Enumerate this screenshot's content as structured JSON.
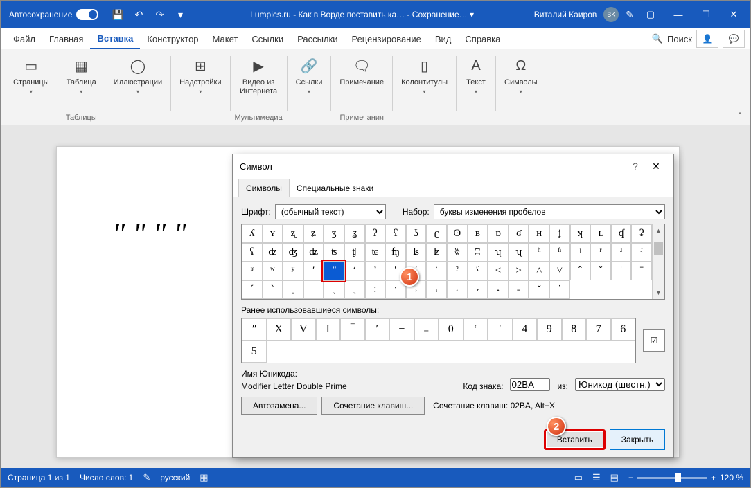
{
  "titlebar": {
    "autosave": "Автосохранение",
    "title": "Lumpics.ru - Как в Ворде поставить ка… - Сохранение… ▾",
    "user": "Виталий Каиров",
    "initials": "BK"
  },
  "menu": {
    "tabs": [
      "Файл",
      "Главная",
      "Вставка",
      "Конструктор",
      "Макет",
      "Ссылки",
      "Рассылки",
      "Рецензирование",
      "Вид",
      "Справка"
    ],
    "active_index": 2,
    "search_placeholder": "Поиск"
  },
  "ribbon": {
    "groups": [
      {
        "label": "",
        "items": [
          {
            "icon": "▭",
            "text": "Страницы",
            "arrow": true
          }
        ]
      },
      {
        "label": "Таблицы",
        "items": [
          {
            "icon": "▦",
            "text": "Таблица",
            "arrow": true
          }
        ]
      },
      {
        "label": "",
        "items": [
          {
            "icon": "◯",
            "text": "Иллюстрации",
            "arrow": true
          }
        ]
      },
      {
        "label": "",
        "items": [
          {
            "icon": "⊞",
            "text": "Надстройки",
            "arrow": true
          }
        ]
      },
      {
        "label": "Мультимедиа",
        "items": [
          {
            "icon": "▶",
            "text": "Видео из\nИнтернета"
          }
        ]
      },
      {
        "label": "",
        "items": [
          {
            "icon": "🔗",
            "text": "Ссылки",
            "arrow": true
          }
        ]
      },
      {
        "label": "Примечания",
        "items": [
          {
            "icon": "🗨",
            "text": "Примечание"
          }
        ]
      },
      {
        "label": "",
        "items": [
          {
            "icon": "▯",
            "text": "Колонтитулы",
            "arrow": true
          }
        ]
      },
      {
        "label": "",
        "items": [
          {
            "icon": "A",
            "text": "Текст",
            "arrow": true
          }
        ]
      },
      {
        "label": "",
        "items": [
          {
            "icon": "Ω",
            "text": "Символы",
            "arrow": true
          }
        ]
      }
    ]
  },
  "document": {
    "text": "ʺ ʺ ʺ ʺ"
  },
  "dialog": {
    "title": "Символ",
    "tabs": [
      "Символы",
      "Специальные знаки"
    ],
    "font_label": "Шрифт:",
    "font_value": "(обычный текст)",
    "subset_label": "Набор:",
    "subset_value": "буквы изменения пробелов",
    "chars": [
      [
        "ʎ",
        "ʏ",
        "ʐ",
        "ʑ",
        "ʒ",
        "ʓ",
        "ʔ",
        "ʕ",
        "ʖ",
        "ʗ",
        "ʘ",
        "ʙ",
        "ɒ",
        "ʛ",
        "ʜ",
        "ʝ",
        "ʞ",
        "ʟ",
        "ʠ"
      ],
      [
        "ʡ",
        "ʢ",
        "ʣ",
        "ʤ",
        "ʥ",
        "ʦ",
        "ʧ",
        "ʨ",
        "ʩ",
        "ʪ",
        "ʫ",
        "ʬ",
        "ʭ",
        "ʮ",
        "ʯ",
        "ʰ",
        "ʱ",
        "ʲ",
        "ʳ"
      ],
      [
        "ʴ",
        "ʵ",
        "ʶ",
        "ʷ",
        "ʸ",
        "ʹ",
        "ʺ",
        "ʻ",
        "ʼ",
        "ʽ",
        "ʾ",
        "ʿ",
        "ˀ",
        "ˁ",
        "˂",
        "˃",
        "˄",
        "˅",
        "ˆ"
      ],
      [
        "ˇ",
        "ˈ",
        "ˉ",
        "ˊ",
        "ˋ",
        "ˌ",
        "ˍ",
        "ˎ",
        "ˏ",
        "ː",
        "ˑ",
        "˒",
        "˓",
        "˔",
        "˕",
        "˖",
        "˗",
        "˘",
        "˙"
      ]
    ],
    "selected_row": 2,
    "selected_col": 6,
    "recent_label": "Ранее использовавшиеся символы:",
    "recent": [
      "ʺ",
      "X",
      "V",
      "I",
      "‾",
      "′",
      "−",
      "₋",
      "0",
      "‘",
      "'",
      "4",
      "9",
      "8",
      "7",
      "6",
      "5",
      "☑"
    ],
    "unicode_label": "Имя Юникода:",
    "unicode_name": "Modifier Letter Double Prime",
    "code_label": "Код знака:",
    "code_value": "02BA",
    "from_label": "из:",
    "from_value": "Юникод (шестн.)",
    "autocorrect_btn": "Автозамена...",
    "shortcut_btn": "Сочетание клавиш...",
    "shortcut_label": "Сочетание клавиш: 02BA, Alt+X",
    "insert_btn": "Вставить",
    "close_btn": "Закрыть"
  },
  "callouts": {
    "c1": "1",
    "c2": "2"
  },
  "statusbar": {
    "page": "Страница 1 из 1",
    "words": "Число слов: 1",
    "lang": "русский",
    "zoom": "120 %"
  }
}
